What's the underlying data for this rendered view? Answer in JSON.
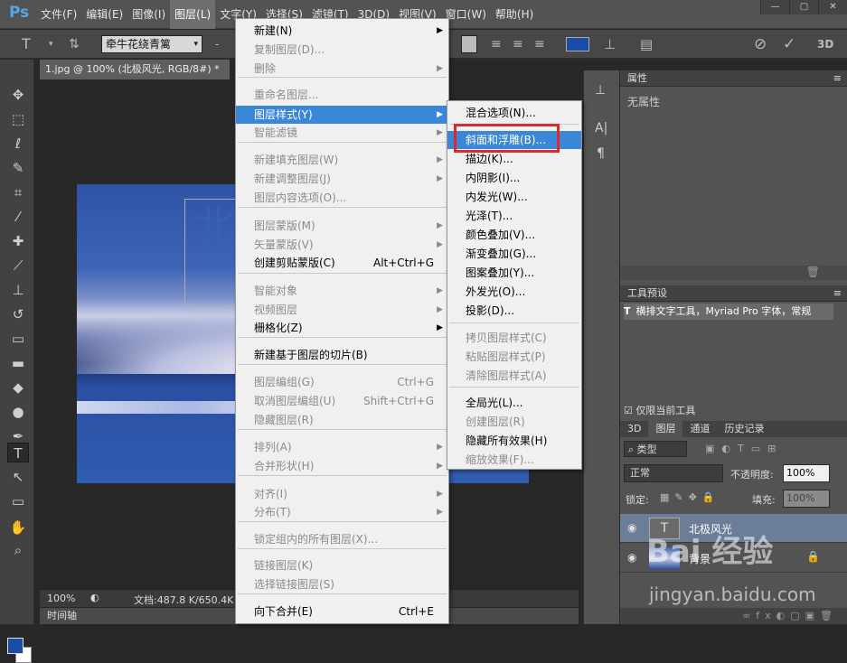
{
  "app": {
    "logo": "Ps"
  },
  "menubar": {
    "items": [
      "文件(F)",
      "编辑(E)",
      "图像(I)",
      "图层(L)",
      "文字(Y)",
      "选择(S)",
      "滤镜(T)",
      "3D(D)",
      "视图(V)",
      "窗口(W)",
      "帮助(H)"
    ],
    "active_index": 3
  },
  "window_controls": {
    "minimize": "—",
    "restore": "▢",
    "close": "✕"
  },
  "options": {
    "font_family": "牵牛花绕青篱",
    "dash": "-",
    "three_d": "3D",
    "cancel_icon": "⊘",
    "commit_icon": "✓"
  },
  "document": {
    "tab": "1.jpg @ 100% (北极风光, RGB/8#) *",
    "close": "×",
    "text_layer_glyph": "北"
  },
  "status": {
    "zoom": "100%",
    "doc_info": "文档:487.8 K/650.4K"
  },
  "timeline": {
    "label": "时间轴"
  },
  "layer_menu": {
    "items": [
      {
        "label": "新建(N)",
        "submenu": true,
        "disabled": false
      },
      {
        "label": "复制图层(D)...",
        "disabled": true
      },
      {
        "label": "删除",
        "submenu": true,
        "disabled": true
      },
      {
        "label": "重命名图层...",
        "disabled": true
      },
      {
        "label": "图层样式(Y)",
        "submenu": true,
        "highlighted": true
      },
      {
        "label": "智能滤镜",
        "submenu": true,
        "disabled": true
      },
      {
        "label": "新建填充图层(W)",
        "submenu": true,
        "disabled": true
      },
      {
        "label": "新建调整图层(J)",
        "submenu": true,
        "disabled": true
      },
      {
        "label": "图层内容选项(O)...",
        "disabled": true
      },
      {
        "label": "图层蒙版(M)",
        "submenu": true,
        "disabled": true
      },
      {
        "label": "矢量蒙版(V)",
        "submenu": true,
        "disabled": true
      },
      {
        "label": "创建剪贴蒙版(C)",
        "shortcut": "Alt+Ctrl+G"
      },
      {
        "label": "智能对象",
        "submenu": true,
        "disabled": true
      },
      {
        "label": "视频图层",
        "submenu": true,
        "disabled": true
      },
      {
        "label": "栅格化(Z)",
        "submenu": true
      },
      {
        "label": "新建基于图层的切片(B)"
      },
      {
        "label": "图层编组(G)",
        "shortcut": "Ctrl+G",
        "disabled": true
      },
      {
        "label": "取消图层编组(U)",
        "shortcut": "Shift+Ctrl+G",
        "disabled": true
      },
      {
        "label": "隐藏图层(R)",
        "disabled": true
      },
      {
        "label": "排列(A)",
        "submenu": true,
        "disabled": true
      },
      {
        "label": "合并形状(H)",
        "submenu": true,
        "disabled": true
      },
      {
        "label": "对齐(I)",
        "submenu": true,
        "disabled": true
      },
      {
        "label": "分布(T)",
        "submenu": true,
        "disabled": true
      },
      {
        "label": "锁定组内的所有图层(X)...",
        "disabled": true
      },
      {
        "label": "链接图层(K)",
        "disabled": true
      },
      {
        "label": "选择链接图层(S)",
        "disabled": true
      },
      {
        "label": "向下合并(E)",
        "shortcut": "Ctrl+E"
      }
    ]
  },
  "style_menu": {
    "items": [
      {
        "label": "混合选项(N)..."
      },
      {
        "label": "斜面和浮雕(B)...",
        "highlighted": true
      },
      {
        "label": "描边(K)..."
      },
      {
        "label": "内阴影(I)..."
      },
      {
        "label": "内发光(W)..."
      },
      {
        "label": "光泽(T)..."
      },
      {
        "label": "颜色叠加(V)..."
      },
      {
        "label": "渐变叠加(G)..."
      },
      {
        "label": "图案叠加(Y)..."
      },
      {
        "label": "外发光(O)..."
      },
      {
        "label": "投影(D)..."
      },
      {
        "label": "拷贝图层样式(C)",
        "disabled": true
      },
      {
        "label": "粘贴图层样式(P)",
        "disabled": true
      },
      {
        "label": "清除图层样式(A)",
        "disabled": true
      },
      {
        "label": "全局光(L)..."
      },
      {
        "label": "创建图层(R)",
        "disabled": true
      },
      {
        "label": "隐藏所有效果(H)"
      },
      {
        "label": "缩放效果(F)...",
        "disabled": true
      }
    ]
  },
  "properties": {
    "title": "属性",
    "empty": "无属性"
  },
  "tool_presets": {
    "title": "工具预设",
    "item": "横排文字工具，Myriad Pro 字体，常规",
    "current_only": "仅限当前工具"
  },
  "layers": {
    "tabs": [
      "3D",
      "图层",
      "通道",
      "历史记录"
    ],
    "active_tab": 1,
    "filter": "类型",
    "blend": "正常",
    "opacity_label": "不透明度:",
    "opacity": "100%",
    "lock_label": "锁定:",
    "fill_label": "填充:",
    "fill": "100%",
    "rows": [
      {
        "name": "北极风光",
        "type": "text",
        "thumb": "T"
      },
      {
        "name": "背景",
        "type": "image"
      }
    ]
  },
  "watermark": {
    "logo": "Bai 经验",
    "url": "jingyan.baidu.com"
  },
  "colors": {
    "accent": "#3a87d8",
    "highlight_box": "#e0272e",
    "foreground": "#1a4ca6",
    "background": "#ffffff"
  }
}
